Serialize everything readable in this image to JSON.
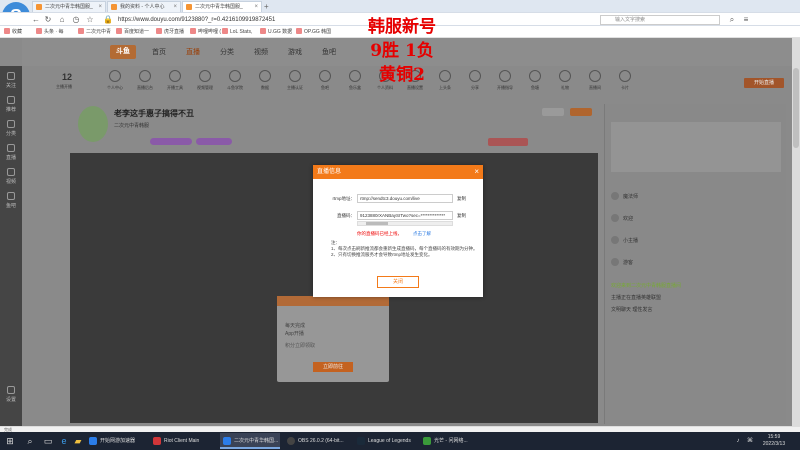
{
  "browser": {
    "tabs": [
      {
        "title": "二次元中青华韩国服_"
      },
      {
        "title": "我的资料 - 个人中心"
      },
      {
        "title": "二次元中青华韩国服_"
      }
    ],
    "url": "https://www.douyu.com/9123880?_r=0.4216109919872451",
    "search_placeholder": "输入文字搜索",
    "bookmarks": [
      "收藏",
      "头条 · 每",
      "二次元中青",
      "百度知道一",
      "虎牙直播",
      "哔哩哔哩 (",
      "LoL Stats,",
      "U.GG 数据",
      "OP.GG 韩国"
    ]
  },
  "overlay": {
    "line1": "韩服新号",
    "line2": "9胜 1负",
    "line3": "黄铜2"
  },
  "site": {
    "logo": "斗鱼",
    "nav": [
      "首页",
      "直播",
      "分类",
      "视频",
      "游戏",
      "鱼吧"
    ],
    "nav_active_index": 1,
    "follow_count": "12",
    "follow_label": "主播开播",
    "categories": [
      "个人中心",
      "直播后台",
      "开播工具",
      "视频管理",
      "斗鱼学院",
      "数据",
      "主播认证",
      "鱼吧",
      "鱼乐盒",
      "个人资料",
      "直播设置",
      "上头条",
      "分享",
      "开播指导",
      "鱼塘",
      "礼物",
      "直播间",
      "卡片"
    ],
    "start_stream": "开始直播",
    "room_title": "老李这手惠子搞得不丑",
    "streamer_name": "二次元中青韩服",
    "left_menu": [
      "关注",
      "推荐",
      "分类",
      "直播",
      "视频",
      "鱼吧",
      "设置"
    ]
  },
  "modal": {
    "title": "直播信息",
    "rtmp_label": "rtmp地址：",
    "rtmp_value": "rtmp://sendtc3.douyu.com/live",
    "code_label": "直播码：",
    "code_value": "9123880rXANBaySITwo?sec=**************",
    "copy": "复制",
    "warning": "你的直播码已经上线，",
    "learn_more": "点击了解",
    "notes_title": "注：",
    "note1": "1、每次点击刷新推流都会重新生成直播码，每个直播码的有效期为分钟。",
    "note2": "2、只有切换推流服务才会导致rtmp地址发生变化。",
    "ok": "关闭"
  },
  "bg_modal": {
    "text1": "每天完成",
    "text2": "App开播",
    "text3": "积分立即领取",
    "button": "立即前往"
  },
  "chat": {
    "lines": [
      "欢迎来到二次元中青韩服直播间",
      "主播正在直播英雄联盟",
      "文明聊天 理性发言"
    ],
    "users": [
      "魔法师",
      "欢迎",
      "小主播",
      "游客"
    ]
  },
  "statusbar": "完成",
  "taskbar": {
    "apps": [
      {
        "name": "开始网游加速器",
        "color": "#2b7de9"
      },
      {
        "name": "Riot Client Main",
        "color": "#d13639"
      },
      {
        "name": "二次元中青华韩国...",
        "color": "#2b7de9"
      },
      {
        "name": "OBS 26.0.2 (64-bit...",
        "color": "#333333"
      },
      {
        "name": "League of Legends",
        "color": "#1a2a3a"
      },
      {
        "name": "光芒 - 问网络...",
        "color": "#3a9a3a"
      }
    ],
    "active_index": 2,
    "time": "15:59",
    "date": "2022/3/13"
  }
}
